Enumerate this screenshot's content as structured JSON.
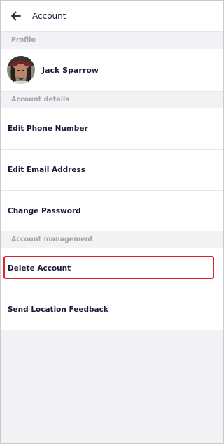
{
  "header": {
    "title": "Account",
    "back_icon": "arrow-left-icon"
  },
  "sections": {
    "profile": {
      "label": "Profile",
      "name": "Jack Sparrow",
      "avatar": "avatar-photo"
    },
    "account_details": {
      "label": "Account details",
      "items": [
        {
          "label": "Edit Phone Number"
        },
        {
          "label": "Edit Email Address"
        },
        {
          "label": "Change Password"
        }
      ]
    },
    "account_management": {
      "label": "Account management",
      "items": [
        {
          "label": "Delete Account",
          "highlighted": true
        },
        {
          "label": "Send Location Feedback"
        }
      ]
    }
  },
  "colors": {
    "text": "#1c1b3a",
    "section_label": "#a5a5ad",
    "background": "#f2f2f4",
    "highlight": "#d7262f"
  }
}
